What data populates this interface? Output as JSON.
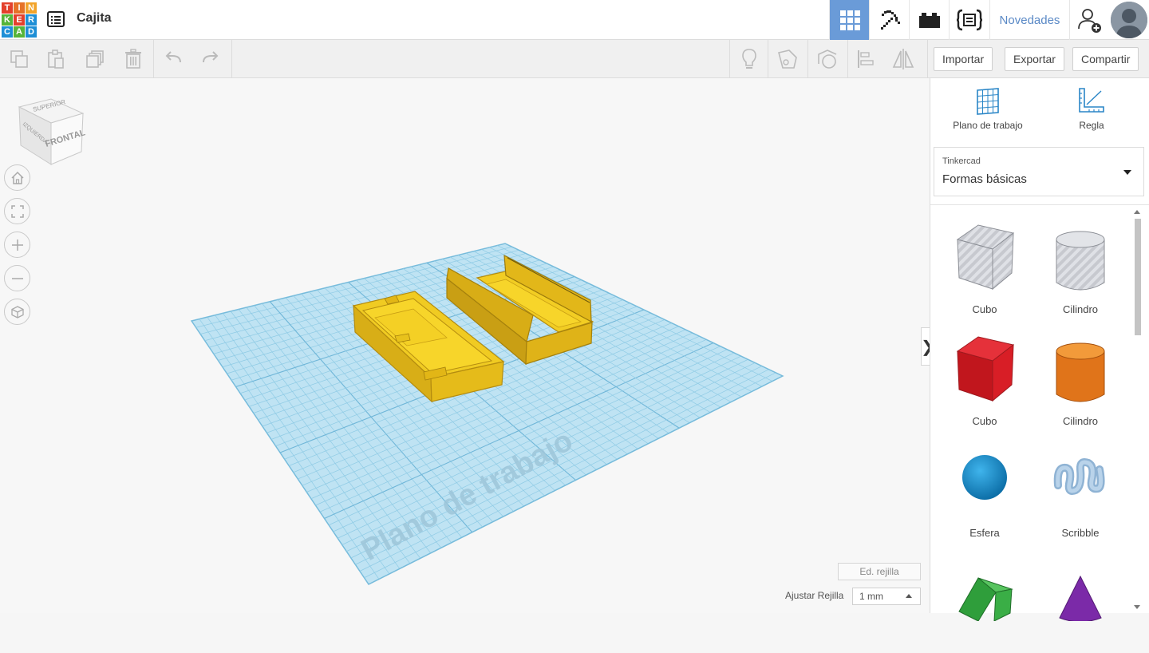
{
  "app": {
    "logo_letters": [
      "T",
      "I",
      "N",
      "K",
      "E",
      "R",
      "C",
      "A",
      "D"
    ],
    "logo_colors": [
      "#e3402c",
      "#e67227",
      "#f2a42b",
      "#56b43a",
      "#e3402c",
      "#1e8fd6",
      "#1e8fd6",
      "#56b43a",
      "#1e8fd6"
    ],
    "design_title": "Cajita"
  },
  "topbar": {
    "views": [
      {
        "name": "3d-design",
        "icon": "grid-icon",
        "active": true
      },
      {
        "name": "build",
        "icon": "pickaxe-icon",
        "active": false
      },
      {
        "name": "bricks",
        "icon": "bricks-icon",
        "active": false
      },
      {
        "name": "codeblocks",
        "icon": "code-blocks-icon",
        "active": false
      }
    ],
    "news_label": "Novedades",
    "add_user_icon": "user-plus-icon"
  },
  "toolbar": {
    "tools": [
      "copy-icon",
      "paste-icon",
      "duplicate-icon",
      "delete-icon",
      "undo-icon",
      "redo-icon"
    ],
    "view_tools": [
      "light-bulb-icon",
      "note-icon",
      "shape-view-icon",
      "align-icon",
      "mirror-icon"
    ],
    "import_label": "Importar",
    "export_label": "Exportar",
    "share_label": "Compartir"
  },
  "workspace": {
    "viewcube_top": "SUPERIOR",
    "viewcube_left": "IZQUIERDA",
    "viewcube_front": "FRONTAL",
    "nav_buttons": [
      "home-icon",
      "fit-view-icon",
      "zoom-in-icon",
      "zoom-out-icon",
      "perspective-icon"
    ],
    "workplane_watermark": "Plano de trabajo",
    "grid_edit_label": "Ed. rejilla",
    "snap_label": "Ajustar Rejilla",
    "snap_value": "1 mm",
    "collapse_glyph": "❯",
    "colors": {
      "grid_fill": "#b9dff0",
      "grid_line": "#8cc8e2",
      "object": "#e9c21e",
      "object_dark": "#c79d14"
    }
  },
  "panel": {
    "workplane_label": "Plano de trabajo",
    "ruler_label": "Regla",
    "library_vendor": "Tinkercad",
    "library_name": "Formas básicas",
    "shapes": [
      {
        "label": "Cubo",
        "icon": "hole-box-icon"
      },
      {
        "label": "Cilindro",
        "icon": "hole-cylinder-icon"
      },
      {
        "label": "Cubo",
        "icon": "box-icon"
      },
      {
        "label": "Cilindro",
        "icon": "cylinder-icon"
      },
      {
        "label": "Esfera",
        "icon": "sphere-icon"
      },
      {
        "label": "Scribble",
        "icon": "scribble-icon"
      },
      {
        "label": "",
        "icon": "roof-icon"
      },
      {
        "label": "",
        "icon": "cone-icon"
      }
    ]
  }
}
